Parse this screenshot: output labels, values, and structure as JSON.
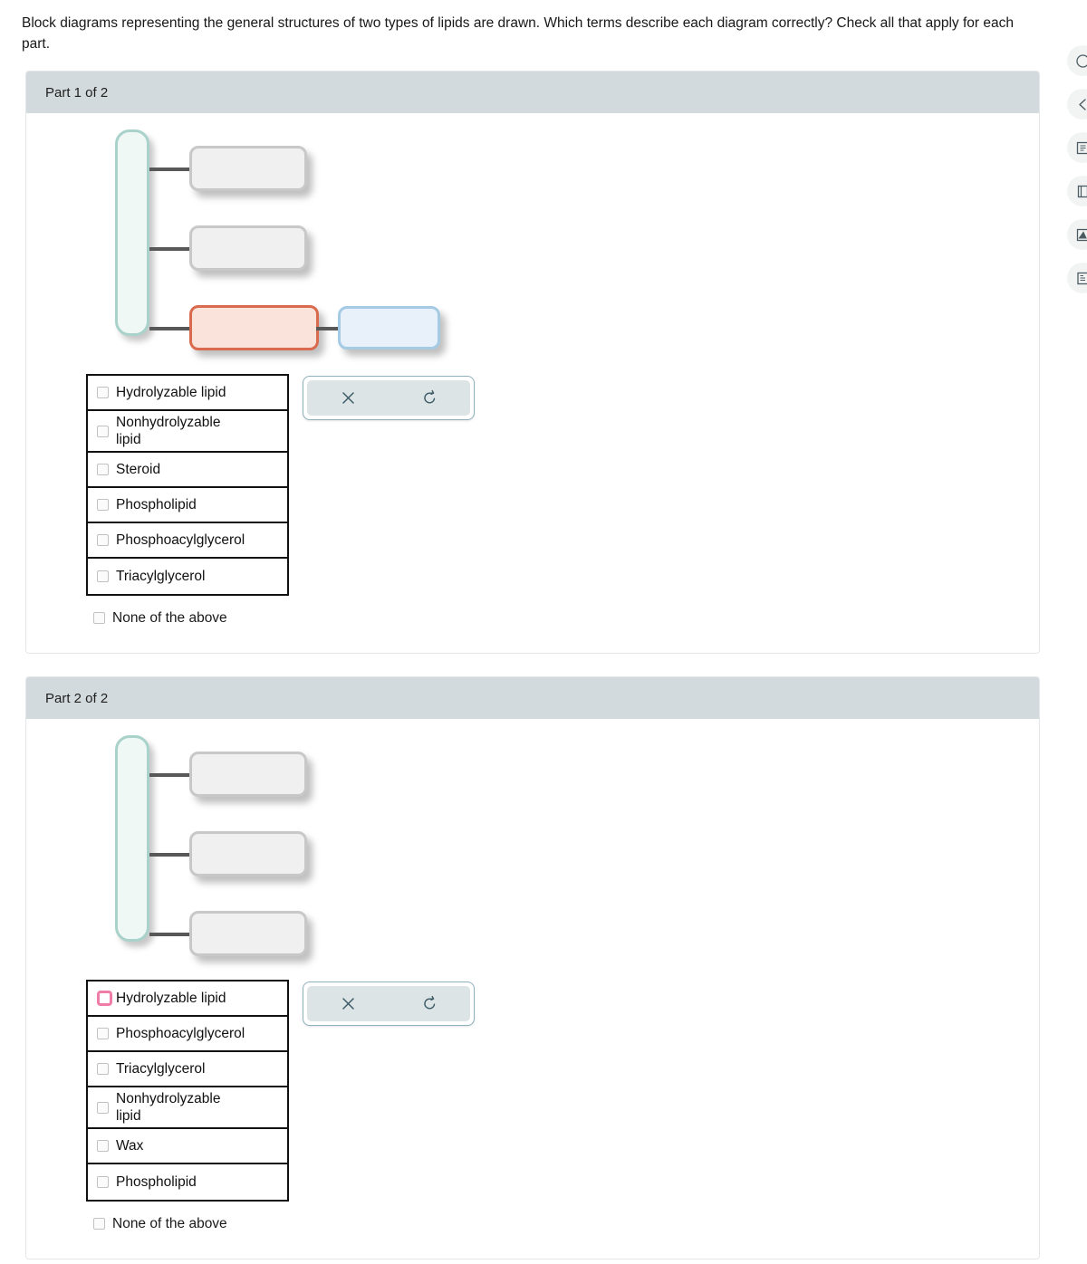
{
  "prompt": {
    "text": "Block diagrams representing the general structures of two types of lipids are drawn. Which terms describe each diagram correctly? Check all that apply for each part."
  },
  "colors": {
    "header_background": "#d2dadd",
    "trunk_border": "#a9d2cb",
    "trunk_fill": "#f0f8f6",
    "gray_block_border": "#c8c8c8",
    "gray_block_fill": "#f0f0f0",
    "salmon_block_border": "#d96a4d",
    "salmon_block_fill": "#fae3da",
    "blue_block_border": "#a5cae4",
    "blue_block_fill": "#e8f1f9",
    "focused_checkbox_border": "#f07ca8",
    "action_bar_fill": "#dde4e6",
    "action_icon": "#3c5a66"
  },
  "parts": [
    {
      "header_title": "Part 1 of 2",
      "diagram": {
        "blocks": [
          {
            "name": "trunk-block",
            "style": "trunk",
            "label": ""
          },
          {
            "name": "branch-block-1",
            "style": "gray",
            "label": ""
          },
          {
            "name": "branch-block-2",
            "style": "gray",
            "label": ""
          },
          {
            "name": "branch-block-3",
            "style": "salmon",
            "label": ""
          },
          {
            "name": "terminal-block",
            "style": "blue",
            "label": ""
          }
        ]
      },
      "choices": [
        {
          "label": "Hydrolyzable lipid",
          "checked": false,
          "focused": false
        },
        {
          "label": "Nonhydrolyzable\nlipid",
          "checked": false,
          "focused": false
        },
        {
          "label": "Steroid",
          "checked": false,
          "focused": false
        },
        {
          "label": "Phospholipid",
          "checked": false,
          "focused": false
        },
        {
          "label": "Phosphoacylglycerol",
          "checked": false,
          "focused": false
        },
        {
          "label": "Triacylglycerol",
          "checked": false,
          "focused": false
        }
      ],
      "none_of_the_above": {
        "label": "None of the above",
        "checked": false
      },
      "actions": [
        {
          "name": "clear-button",
          "icon": "close-icon"
        },
        {
          "name": "reset-button",
          "icon": "undo-icon"
        }
      ]
    },
    {
      "header_title": "Part 2 of 2",
      "diagram": {
        "blocks": [
          {
            "name": "trunk-block",
            "style": "trunk",
            "label": ""
          },
          {
            "name": "branch-block-1",
            "style": "gray",
            "label": ""
          },
          {
            "name": "branch-block-2",
            "style": "gray",
            "label": ""
          },
          {
            "name": "branch-block-3",
            "style": "gray",
            "label": ""
          }
        ]
      },
      "choices": [
        {
          "label": "Hydrolyzable lipid",
          "checked": false,
          "focused": true
        },
        {
          "label": "Phosphoacylglycerol",
          "checked": false,
          "focused": false
        },
        {
          "label": "Triacylglycerol",
          "checked": false,
          "focused": false
        },
        {
          "label": "Nonhydrolyzable\nlipid",
          "checked": false,
          "focused": false
        },
        {
          "label": "Wax",
          "checked": false,
          "focused": false
        },
        {
          "label": "Phospholipid",
          "checked": false,
          "focused": false
        }
      ],
      "none_of_the_above": {
        "label": "None of the above",
        "checked": false
      },
      "actions": [
        {
          "name": "clear-button",
          "icon": "close-icon"
        },
        {
          "name": "reset-button",
          "icon": "undo-icon"
        }
      ]
    }
  ],
  "right_rail": {
    "items": [
      {
        "name": "help-icon"
      },
      {
        "name": "chevron-left-icon"
      },
      {
        "name": "list-icon"
      },
      {
        "name": "book-icon"
      },
      {
        "name": "pencil-note-icon"
      },
      {
        "name": "document-icon"
      }
    ]
  }
}
